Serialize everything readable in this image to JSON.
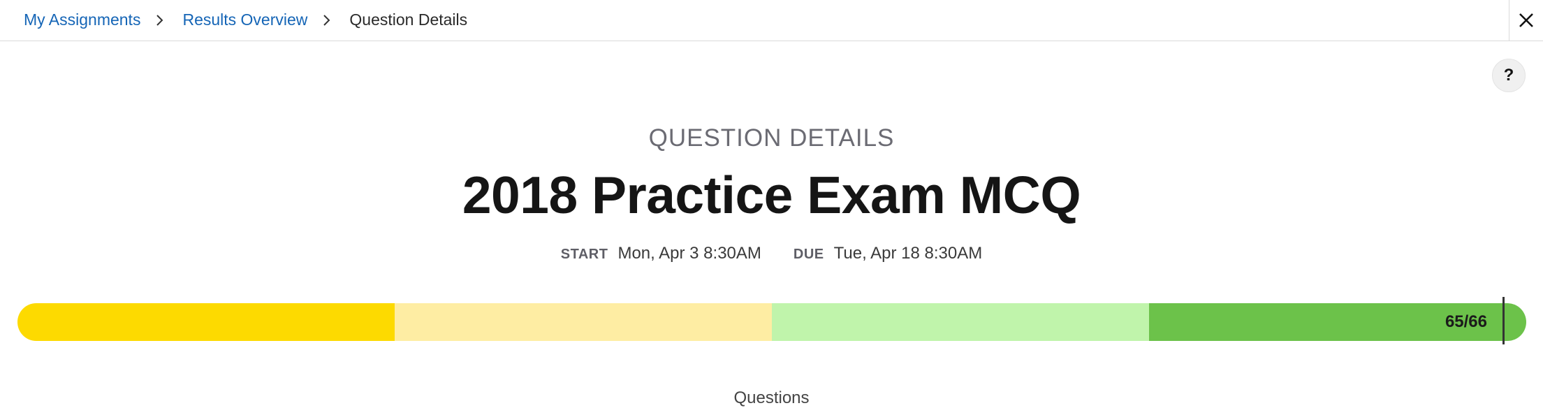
{
  "breadcrumb": {
    "items": [
      {
        "label": "My Assignments"
      },
      {
        "label": "Results Overview"
      }
    ],
    "current": "Question Details",
    "separator": ">"
  },
  "close_icon": "close-icon",
  "help": {
    "label": "?"
  },
  "header": {
    "eyebrow": "QUESTION DETAILS",
    "title": "2018 Practice Exam MCQ"
  },
  "dates": {
    "start_label": "START",
    "start_value": "Mon, Apr 3 8:30AM",
    "due_label": "DUE",
    "due_value": "Tue, Apr 18 8:30AM"
  },
  "progress": {
    "label": "65/66",
    "score": 65,
    "total": 66,
    "segment_colors": [
      "#fdda00",
      "#feeda3",
      "#c0f4ab",
      "#6cc24a"
    ]
  },
  "section": {
    "label": "Questions"
  },
  "colors": {
    "link": "#1565b6"
  }
}
